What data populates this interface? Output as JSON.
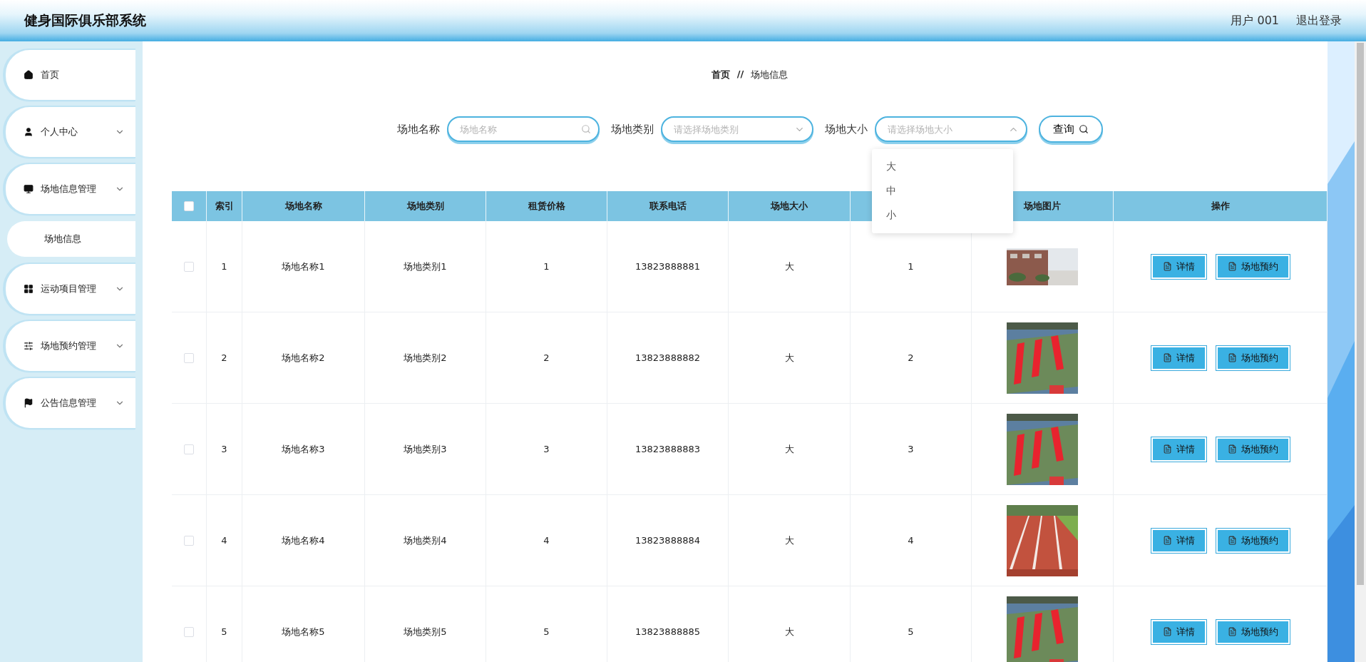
{
  "header": {
    "title": "健身国际俱乐部系统",
    "user": "用户 001",
    "logout": "退出登录"
  },
  "sidebar": {
    "items": [
      {
        "label": "首页",
        "kind": "link"
      },
      {
        "label": "个人中心",
        "kind": "menu"
      },
      {
        "label": "场地信息管理",
        "kind": "menu",
        "children": [
          {
            "label": "场地信息"
          }
        ]
      },
      {
        "label": "运动项目管理",
        "kind": "menu"
      },
      {
        "label": "场地预约管理",
        "kind": "menu"
      },
      {
        "label": "公告信息管理",
        "kind": "menu"
      }
    ]
  },
  "breadcrumb": [
    "首页",
    "//",
    "场地信息"
  ],
  "search": {
    "fields": [
      {
        "label": "场地名称",
        "kind": "input",
        "placeholder": "场地名称"
      },
      {
        "label": "场地类别",
        "kind": "select",
        "placeholder": "请选择场地类别",
        "expanded": false
      },
      {
        "label": "场地大小",
        "kind": "select",
        "placeholder": "请选择场地大小",
        "expanded": true,
        "options": [
          {
            "label": "大",
            "selected": false
          },
          {
            "label": "中",
            "selected": false
          },
          {
            "label": "小",
            "selected": false
          }
        ]
      }
    ],
    "button": "查询"
  },
  "table": {
    "select_all_checked": false,
    "columns": [
      {
        "label": "索引"
      },
      {
        "label": "场地名称"
      },
      {
        "label": "场地类别"
      },
      {
        "label": "租赁价格"
      },
      {
        "label": "联系电话"
      },
      {
        "label": "场地大小"
      },
      {},
      {
        "label": "场地图片"
      },
      {
        "label": "操作"
      }
    ],
    "rows": [
      {
        "checked": false,
        "cells": [
          "1",
          "场地名称1",
          "场地类别1",
          "1",
          "13823888881",
          "大",
          "1"
        ],
        "picture": {
          "kind": "picture"
        },
        "actions": [
          "详情",
          "场地预约"
        ]
      },
      {
        "checked": false,
        "cells": [
          "2",
          "场地名称2",
          "场地类别2",
          "2",
          "13823888882",
          "大",
          "2"
        ],
        "picture": {
          "kind": "picture"
        },
        "actions": [
          "详情",
          "场地预约"
        ]
      },
      {
        "checked": false,
        "cells": [
          "3",
          "场地名称3",
          "场地类别3",
          "3",
          "13823888883",
          "大",
          "3"
        ],
        "picture": {
          "kind": "picture"
        },
        "actions": [
          "详情",
          "场地预约"
        ]
      },
      {
        "checked": false,
        "cells": [
          "4",
          "场地名称4",
          "场地类别4",
          "4",
          "13823888884",
          "大",
          "4"
        ],
        "picture": {
          "kind": "picture"
        },
        "actions": [
          "详情",
          "场地预约"
        ]
      },
      {
        "checked": false,
        "cells": [
          "5",
          "场地名称5",
          "场地类别5",
          "5",
          "13823888885",
          "大",
          "5"
        ],
        "picture": {
          "kind": "picture"
        },
        "actions": [
          "详情",
          "场地预约"
        ]
      }
    ]
  }
}
